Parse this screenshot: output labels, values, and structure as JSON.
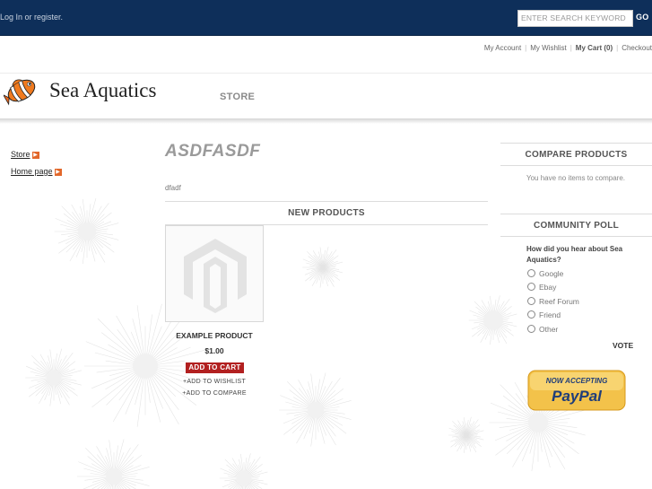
{
  "topbar": {
    "login_text": "Log In or register.",
    "search_placeholder": "ENTER SEARCH KEYWORD",
    "go_label": "GO"
  },
  "account_links": {
    "my_account": "My Account",
    "my_wishlist": "My Wishlist",
    "my_cart": "My Cart (0)",
    "checkout": "Checkout"
  },
  "header": {
    "logo_text": "Sea Aquatics",
    "nav_store": "STORE"
  },
  "left_nav": {
    "items": [
      {
        "label": "Store"
      },
      {
        "label": "Home page"
      }
    ]
  },
  "main": {
    "title": "ASDFASDF",
    "description": "dfadf",
    "new_products_heading": "NEW PRODUCTS",
    "product": {
      "name": "EXAMPLE PRODUCT",
      "price": "$1.00",
      "add_to_cart": "ADD TO CART",
      "add_to_wishlist": "+ADD TO WISHLIST",
      "add_to_compare": "+ADD TO COMPARE"
    }
  },
  "sidebar_right": {
    "compare": {
      "title": "COMPARE PRODUCTS",
      "empty_text": "You have no items to compare."
    },
    "poll": {
      "title": "COMMUNITY POLL",
      "question": "How did you hear about Sea Aquatics?",
      "options": [
        "Google",
        "Ebay",
        "Reef Forum",
        "Friend",
        "Other"
      ],
      "vote_label": "VOTE"
    },
    "paypal": {
      "line1": "NOW ACCEPTING",
      "line2": "PayPal"
    }
  },
  "colors": {
    "topbar_bg": "#0e2f5a",
    "add_to_cart_bg": "#b22020",
    "arrow_orange": "#e2672a",
    "paypal_gold": "#f3c24a"
  }
}
